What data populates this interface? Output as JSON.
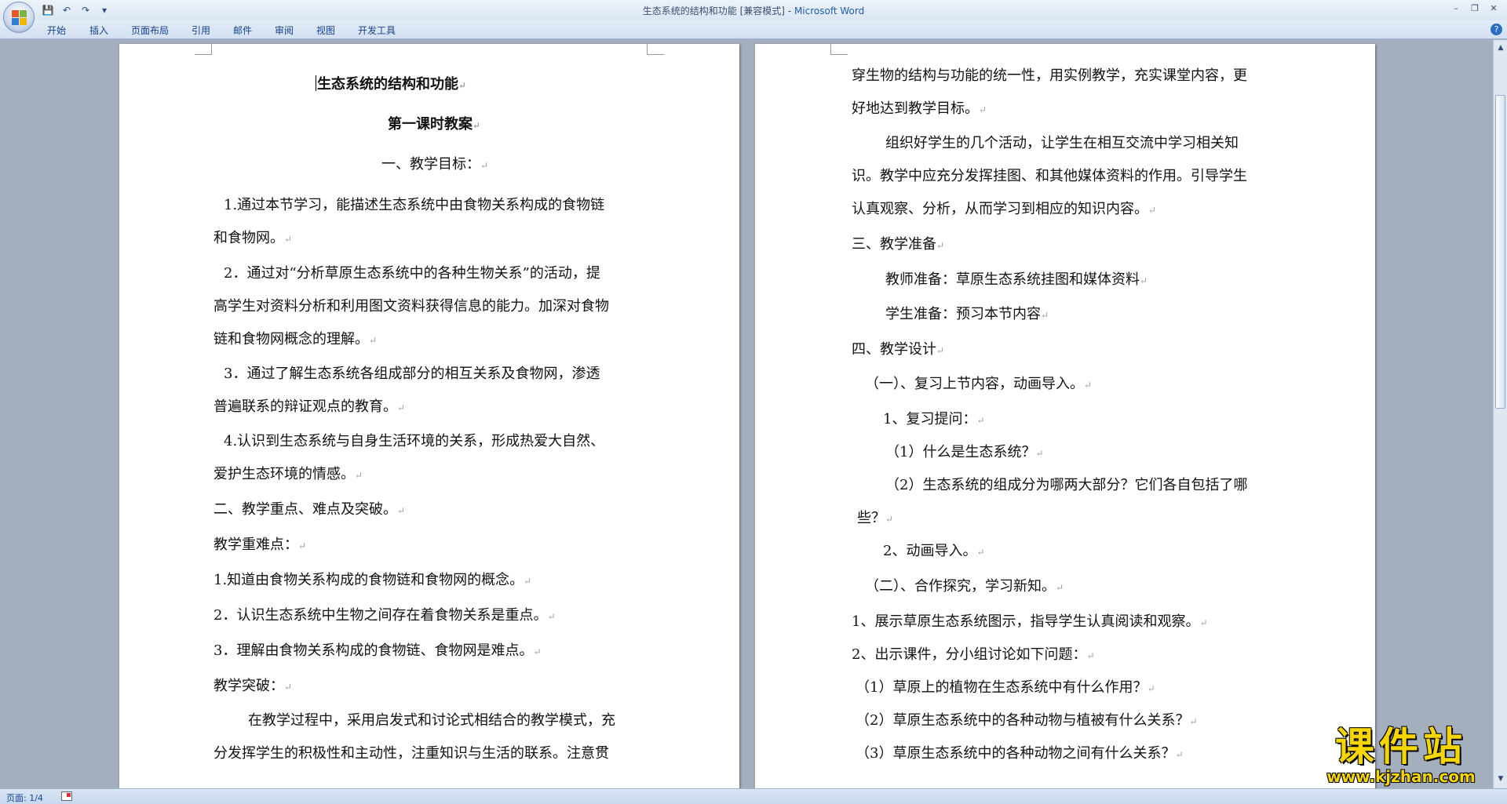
{
  "window": {
    "doc_title": "生态系统的结构和功能 [兼容模式]",
    "separator": " - ",
    "app_name": "Microsoft Word"
  },
  "qat": {
    "save": "💾",
    "undo": "↶",
    "redo": "↷",
    "customize": "▾"
  },
  "window_controls": {
    "minimize": "–",
    "restore": "❐",
    "close": "✕"
  },
  "tabs": [
    "开始",
    "插入",
    "页面布局",
    "引用",
    "邮件",
    "审阅",
    "视图",
    "开发工具"
  ],
  "help": "?",
  "paragraph_mark": "↵",
  "page1_lines": [
    "生态系统的结构和功能",
    "第一课时教案",
    "一、教学目标：",
    "1.通过本节学习，能描述生态系统中由食物关系构成的食物链",
    "和食物网。",
    "2．通过对“分析草原生态系统中的各种生物关系”的活动，提",
    "高学生对资料分析和利用图文资料获得信息的能力。加深对食物",
    "链和食物网概念的理解。",
    "3．通过了解生态系统各组成部分的相互关系及食物网，渗透",
    "普遍联系的辩证观点的教育。",
    "4.认识到生态系统与自身生活环境的关系，形成热爱大自然、",
    "爱护生态环境的情感。",
    "二、教学重点、难点及突破。",
    "教学重难点：",
    "1.知道由食物关系构成的食物链和食物网的概念。",
    "2．认识生态系统中生物之间存在着食物关系是重点。",
    "3．理解由食物关系构成的食物链、食物网是难点。",
    "教学突破：",
    "在教学过程中，采用启发式和讨论式相结合的教学模式，充",
    "分发挥学生的积极性和主动性，注重知识与生活的联系。注意贯"
  ],
  "page2_lines": [
    "穿生物的结构与功能的统一性，用实例教学，充实课堂内容，更",
    "好地达到教学目标。",
    "组织好学生的几个活动，让学生在相互交流中学习相关知",
    "识。教学中应充分发挥挂图、和其他媒体资料的作用。引导学生",
    "认真观察、分析，从而学习到相应的知识内容。",
    "三、教学准备",
    "教师准备：草原生态系统挂图和媒体资料",
    "学生准备：预习本节内容",
    "四、教学设计",
    "（一）、复习上节内容，动画导入。",
    "1、复习提问：",
    "（1）什么是生态系统？",
    "（2）生态系统的组成分为哪两大部分？它们各自包括了哪",
    "些？",
    "2、动画导入。",
    "（二）、合作探究，学习新知。",
    "1、展示草原生态系统图示，指导学生认真阅读和观察。",
    "2、出示课件，分小组讨论如下问题：",
    "（1）草原上的植物在生态系统中有什么作用？",
    "（2）草原生态系统中的各种动物与植被有什么关系？",
    "（3）草原生态系统中的各种动物之间有什么关系？"
  ],
  "status": {
    "page": "页面: 1/4"
  },
  "watermark": {
    "main": "课件站",
    "url": "www.kjzhan.com"
  },
  "scrollbar": {
    "up": "▲",
    "down": "▼"
  }
}
